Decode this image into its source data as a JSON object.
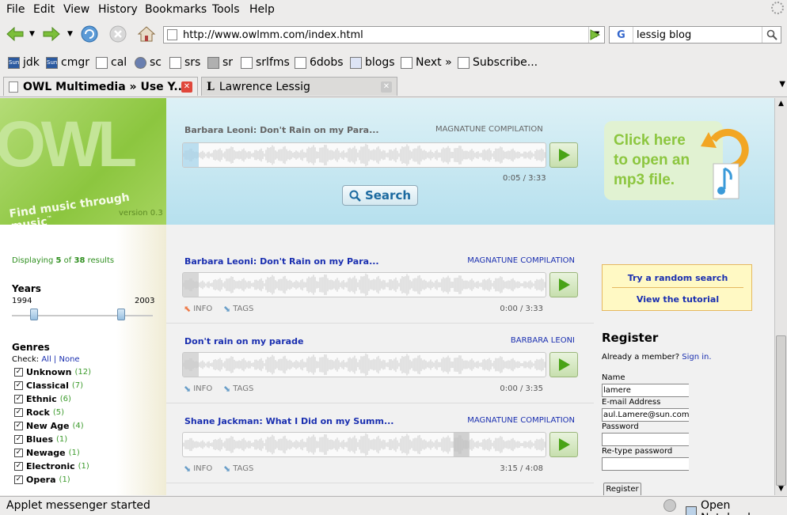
{
  "menu": [
    "File",
    "Edit",
    "View",
    "History",
    "Bookmarks",
    "Tools",
    "Help"
  ],
  "url": "http://www.owlmm.com/index.html",
  "search_query": "lessig blog",
  "bookmarks": [
    "jdk",
    "cmgr",
    "cal",
    "sc",
    "srs",
    "sr",
    "srlfms",
    "6dobs",
    "blogs",
    "Next »",
    "Subscribe..."
  ],
  "tabs": [
    {
      "title": "OWL Multimedia » Use Y..."
    },
    {
      "title": "Lawrence Lessig"
    }
  ],
  "status": {
    "left": "Applet messenger started",
    "right": "Open Notebook"
  },
  "owl": {
    "logo": "OWL",
    "tagline": "Find music through music",
    "trademark": "™",
    "version": "version 0.3",
    "now_playing": {
      "title": "Barbara Leoni: Don't Rain on my Para...",
      "artist": "MAGNATUNE COMPILATION",
      "time": "0:05 / 3:33",
      "progress": 0.023
    },
    "search_label": "Search",
    "open_mp3": [
      "Click here",
      "to open an",
      "mp3 file."
    ],
    "results_prefix": "Displaying ",
    "results_shown": "5",
    "results_of": " of ",
    "results_total": "38",
    "results_suffix": " results",
    "years": {
      "label": "Years",
      "min": "1994",
      "max": "2003"
    },
    "genres": {
      "label": "Genres",
      "check_label": "Check:",
      "all": "All",
      "sep": "|",
      "none": "None",
      "items": [
        {
          "name": "Unknown",
          "count": "(12)"
        },
        {
          "name": "Classical",
          "count": "(7)"
        },
        {
          "name": "Ethnic",
          "count": "(6)"
        },
        {
          "name": "Rock",
          "count": "(5)"
        },
        {
          "name": "New Age",
          "count": "(4)"
        },
        {
          "name": "Blues",
          "count": "(1)"
        },
        {
          "name": "Newage",
          "count": "(1)"
        },
        {
          "name": "Electronic",
          "count": "(1)"
        },
        {
          "name": "Opera",
          "count": "(1)"
        }
      ]
    },
    "tracks": [
      {
        "title": "Barbara Leoni: Don't Rain on my Para...",
        "artist": "MAGNATUNE COMPILATION",
        "time": "0:00 / 3:33",
        "info": "INFO",
        "tags": "TAGS",
        "progress": 0.0
      },
      {
        "title": "Don't rain on my parade",
        "artist": "BARBARA LEONI",
        "time": "0:00 / 3:35",
        "info": "INFO",
        "tags": "TAGS",
        "progress": 0.0
      },
      {
        "title": "Shane Jackman: What I Did on my Summ...",
        "artist": "MAGNATUNE COMPILATION",
        "time": "3:15 / 4:08",
        "info": "INFO",
        "tags": "TAGS",
        "progress": 0.79
      }
    ],
    "links": {
      "random": "Try a random search",
      "tutorial": "View the tutorial"
    },
    "register": {
      "title": "Register",
      "member_text": "Already a member? ",
      "signin": "Sign in.",
      "name_label": "Name",
      "name_value": "lamere",
      "email_label": "E-mail Address",
      "email_value": "aul.Lamere@sun.comt",
      "password_label": "Password",
      "retype_label": "Re-type password",
      "button": "Register"
    }
  },
  "colors": {
    "link": "#1a2fb0",
    "green": "#8cc63f",
    "count": "#3a9a2a",
    "close_red": "#e0473b"
  }
}
